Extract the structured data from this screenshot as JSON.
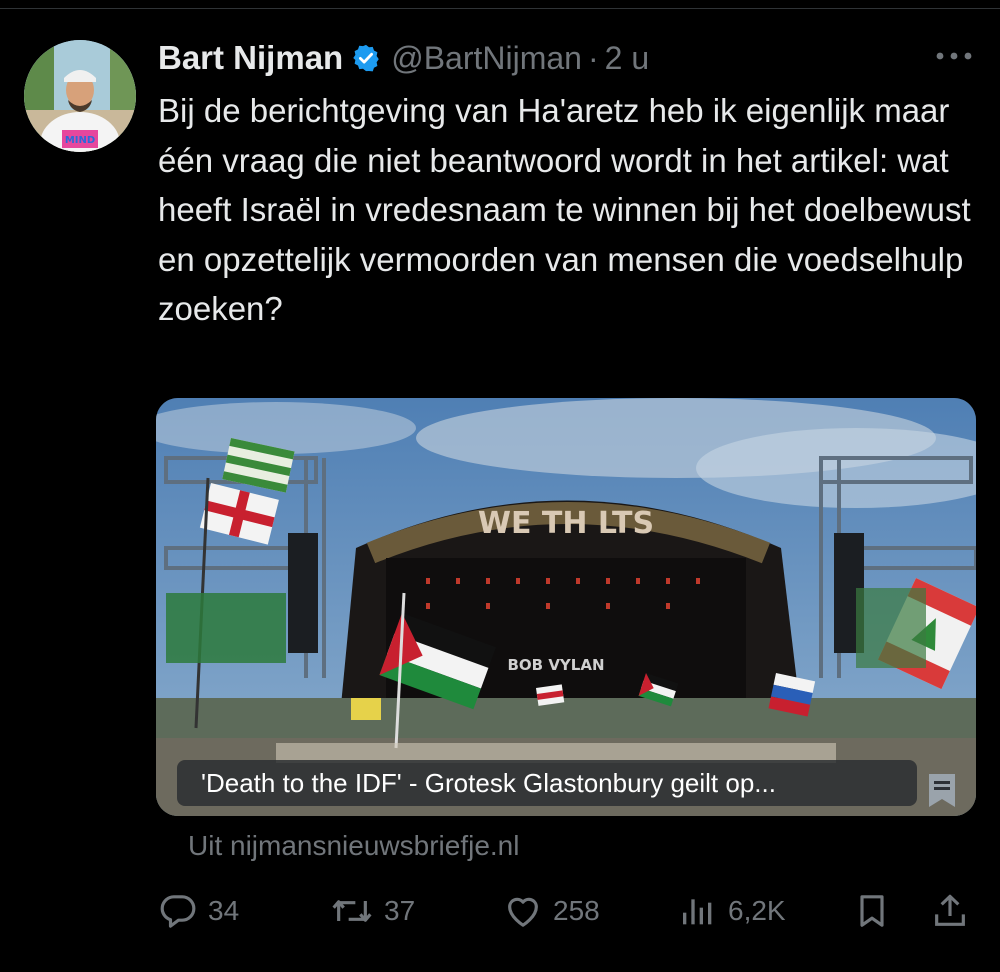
{
  "author": {
    "display_name": "Bart Nijman",
    "handle": "@BartNijman",
    "separator": "·",
    "time": "2 u",
    "verified": true,
    "avatar_shirt_text": "MIND"
  },
  "tweet": {
    "text": "Bij de berichtgeving van Ha'aretz heb ik eigenlijk maar één vraag die niet beantwoord wordt in het artikel: wat heeft Israël in vredesnaam te winnen bij het doelbewust en opzettelijk vermoorden van mensen die voedselhulp zoeken?"
  },
  "card": {
    "title": "'Death to the IDF' - Grotesk Glastonbury geilt op...",
    "source": "Uit nijmansnieuwsbriefje.nl",
    "image_stage_banner": "WE    TH    LTS",
    "image_stage_sign": "BOB VYLAN",
    "image_subject": "festival stage with flags"
  },
  "actions": {
    "replies": "34",
    "reposts": "37",
    "likes": "258",
    "views": "6,2K"
  },
  "icons": {
    "verified": "verified-badge-icon",
    "more": "more-icon",
    "reply": "reply-icon",
    "repost": "repost-icon",
    "like": "heart-icon",
    "views": "views-icon",
    "bookmark": "bookmark-icon",
    "share": "share-icon"
  },
  "colors": {
    "background": "#000000",
    "text": "#e7e9ea",
    "secondary_text": "#71767b",
    "verified_blue": "#1d9bf0"
  }
}
